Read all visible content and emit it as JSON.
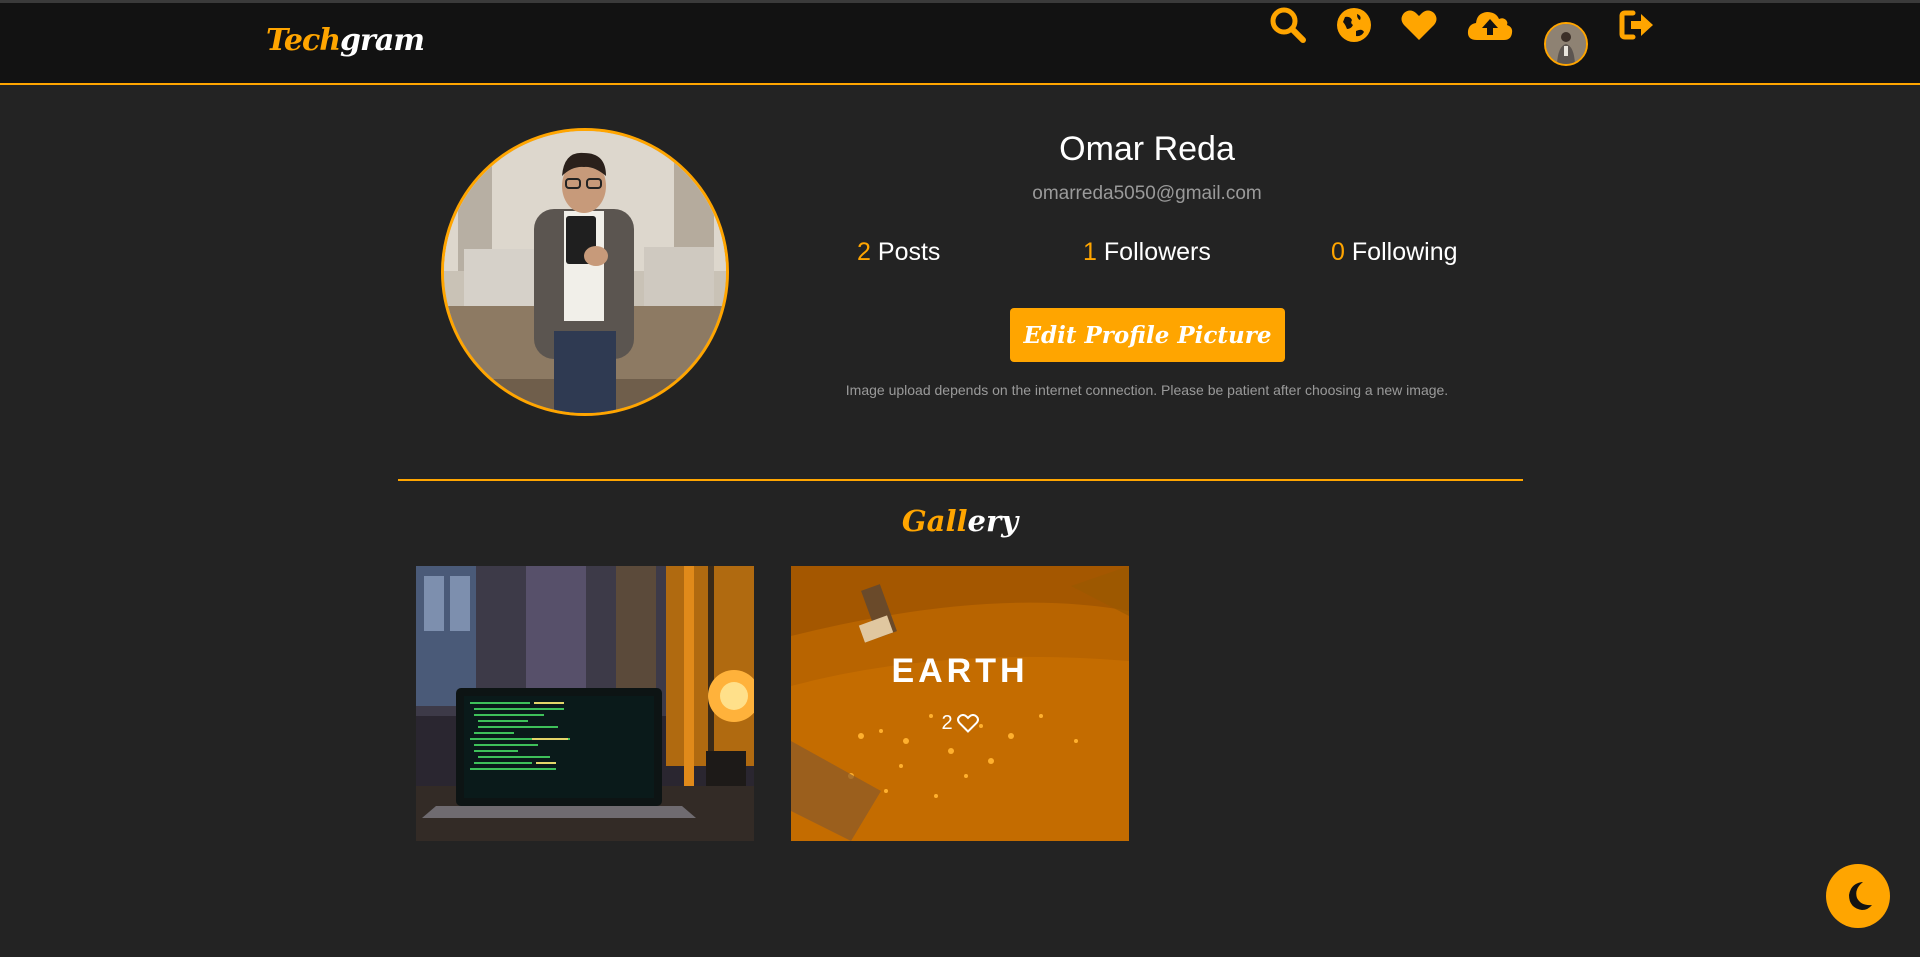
{
  "app": {
    "brand_accent": "Tech",
    "brand_rest": "gram"
  },
  "nav": {
    "icons": [
      "search-icon",
      "globe-icon",
      "heart-icon",
      "cloud-upload-icon",
      "avatar",
      "logout-icon"
    ]
  },
  "profile": {
    "name": "Omar Reda",
    "email": "omarreda5050@gmail.com",
    "stats": [
      {
        "count": "2",
        "label": "Posts"
      },
      {
        "count": "1",
        "label": "Followers"
      },
      {
        "count": "0",
        "label": "Following"
      }
    ],
    "edit_button": "Edit Profile Picture",
    "upload_note": "Image upload depends on the internet connection. Please be patient after choosing a new image."
  },
  "gallery": {
    "title_accent": "Gall",
    "title_rest": "ery",
    "posts": [
      {
        "label": "",
        "likes": ""
      },
      {
        "label": "EARTH",
        "likes": "2"
      }
    ]
  },
  "theme_toggle": {
    "icon": "moon-icon"
  },
  "colors": {
    "accent": "#ffa500",
    "background": "#232323",
    "navbar": "#121212"
  }
}
